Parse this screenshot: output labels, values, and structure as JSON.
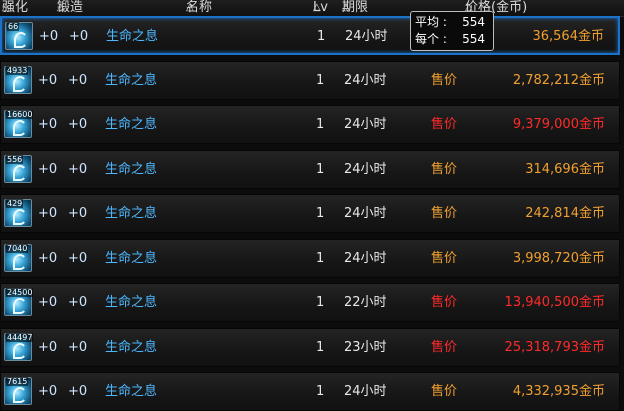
{
  "header": {
    "enhance": "强化",
    "forge": "锻造",
    "name": "名称",
    "lv": "Lv",
    "term": "期限",
    "price": "价格(金币)",
    "sort_arrow": "△"
  },
  "tooltip": {
    "avg_label": "平均",
    "avg_value": "554",
    "each_label": "每个",
    "each_value": "554"
  },
  "rows": [
    {
      "count": "66",
      "enhance": "+0",
      "forge": "+0",
      "name": "生命之息",
      "lv": "1",
      "term": "24小时",
      "sell_label": "",
      "price": "36,564",
      "unit": "金币",
      "price_color": "orange"
    },
    {
      "count": "4933",
      "enhance": "+0",
      "forge": "+0",
      "name": "生命之息",
      "lv": "1",
      "term": "24小时",
      "sell_label": "售价",
      "price": "2,782,212",
      "unit": "金币",
      "price_color": "orange"
    },
    {
      "count": "16600",
      "enhance": "+0",
      "forge": "+0",
      "name": "生命之息",
      "lv": "1",
      "term": "24小时",
      "sell_label": "售价",
      "price": "9,379,000",
      "unit": "金币",
      "price_color": "red"
    },
    {
      "count": "556",
      "enhance": "+0",
      "forge": "+0",
      "name": "生命之息",
      "lv": "1",
      "term": "24小时",
      "sell_label": "售价",
      "price": "314,696",
      "unit": "金币",
      "price_color": "orange"
    },
    {
      "count": "429",
      "enhance": "+0",
      "forge": "+0",
      "name": "生命之息",
      "lv": "1",
      "term": "24小时",
      "sell_label": "售价",
      "price": "242,814",
      "unit": "金币",
      "price_color": "orange"
    },
    {
      "count": "7040",
      "enhance": "+0",
      "forge": "+0",
      "name": "生命之息",
      "lv": "1",
      "term": "24小时",
      "sell_label": "售价",
      "price": "3,998,720",
      "unit": "金币",
      "price_color": "orange"
    },
    {
      "count": "24500",
      "enhance": "+0",
      "forge": "+0",
      "name": "生命之息",
      "lv": "1",
      "term": "22小时",
      "sell_label": "售价",
      "price": "13,940,500",
      "unit": "金币",
      "price_color": "red"
    },
    {
      "count": "44497",
      "enhance": "+0",
      "forge": "+0",
      "name": "生命之息",
      "lv": "1",
      "term": "23小时",
      "sell_label": "售价",
      "price": "25,318,793",
      "unit": "金币",
      "price_color": "red"
    },
    {
      "count": "7615",
      "enhance": "+0",
      "forge": "+0",
      "name": "生命之息",
      "lv": "1",
      "term": "24小时",
      "sell_label": "售价",
      "price": "4,332,935",
      "unit": "金币",
      "price_color": "orange"
    }
  ],
  "colors": {
    "orange": "#f0a030",
    "red": "#ff2a2a",
    "name": "#4db8ff",
    "selected_border": "#1a73c9"
  }
}
